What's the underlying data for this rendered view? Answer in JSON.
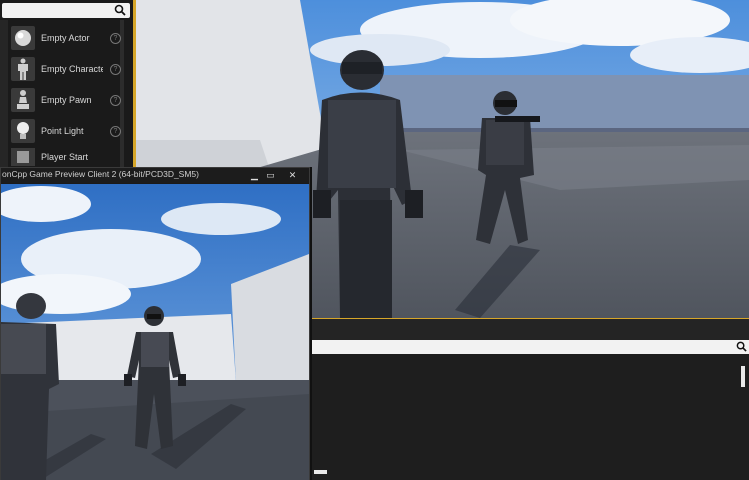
{
  "place_actors": {
    "search": {
      "placeholder": "",
      "icon": "search-icon"
    },
    "items": [
      {
        "label": "Empty Actor",
        "icon": "sphere-icon"
      },
      {
        "label": "Empty Characte",
        "icon": "mannequin-icon"
      },
      {
        "label": "Empty Pawn",
        "icon": "pawn-icon"
      },
      {
        "label": "Point Light",
        "icon": "light-bulb-icon"
      },
      {
        "label": "Player Start",
        "icon": "player-start-icon"
      }
    ],
    "help_glyph": "?"
  },
  "preview_window": {
    "title": "onCpp Game Preview Client 2 (64-bit/PCD3D_SM5)",
    "minimize": "▁",
    "maximize": "▭",
    "close": "✕"
  },
  "colors": {
    "accent": "#d6a629",
    "panel_bg": "#1a1a1a",
    "sky": "#3d7fd0",
    "floor": "#4a4f5a"
  }
}
